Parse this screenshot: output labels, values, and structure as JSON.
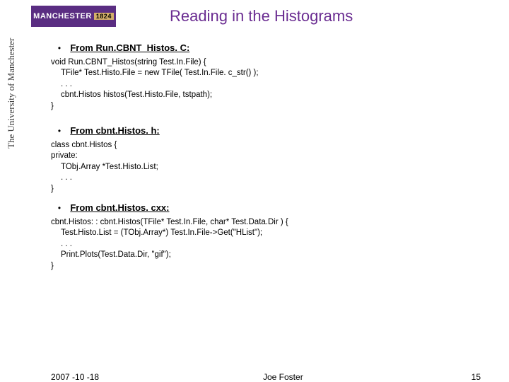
{
  "logo": {
    "name": "MANCHESTER",
    "year": "1824"
  },
  "sidebar": "The University of Manchester",
  "title": "Reading in the Histograms",
  "sections": [
    {
      "heading": "From Run.CBNT_Histos. C:",
      "lines": [
        "void Run.CBNT_Histos(string Test.In.File) {",
        "  TFile* Test.Histo.File = new TFile( Test.In.File. c_str() );",
        "  . . .",
        "  cbnt.Histos  histos(Test.Histo.File, tstpath);",
        "}"
      ]
    },
    {
      "heading": "From cbnt.Histos. h:",
      "lines": [
        "class cbnt.Histos {",
        " private:",
        "  TObj.Array  *Test.Histo.List;",
        "  . . .",
        "}"
      ]
    },
    {
      "heading": "From cbnt.Histos. cxx:",
      "lines": [
        "cbnt.Histos: : cbnt.Histos(TFile* Test.In.File, char* Test.Data.Dir ) {",
        "  Test.Histo.List = (TObj.Array*) Test.In.File->Get(\"HList\");",
        "  . . .",
        "  Print.Plots(Test.Data.Dir, \"gif\");",
        "}"
      ]
    }
  ],
  "footer": {
    "date": "2007 -10 -18",
    "author": "Joe Foster",
    "page": "15"
  }
}
